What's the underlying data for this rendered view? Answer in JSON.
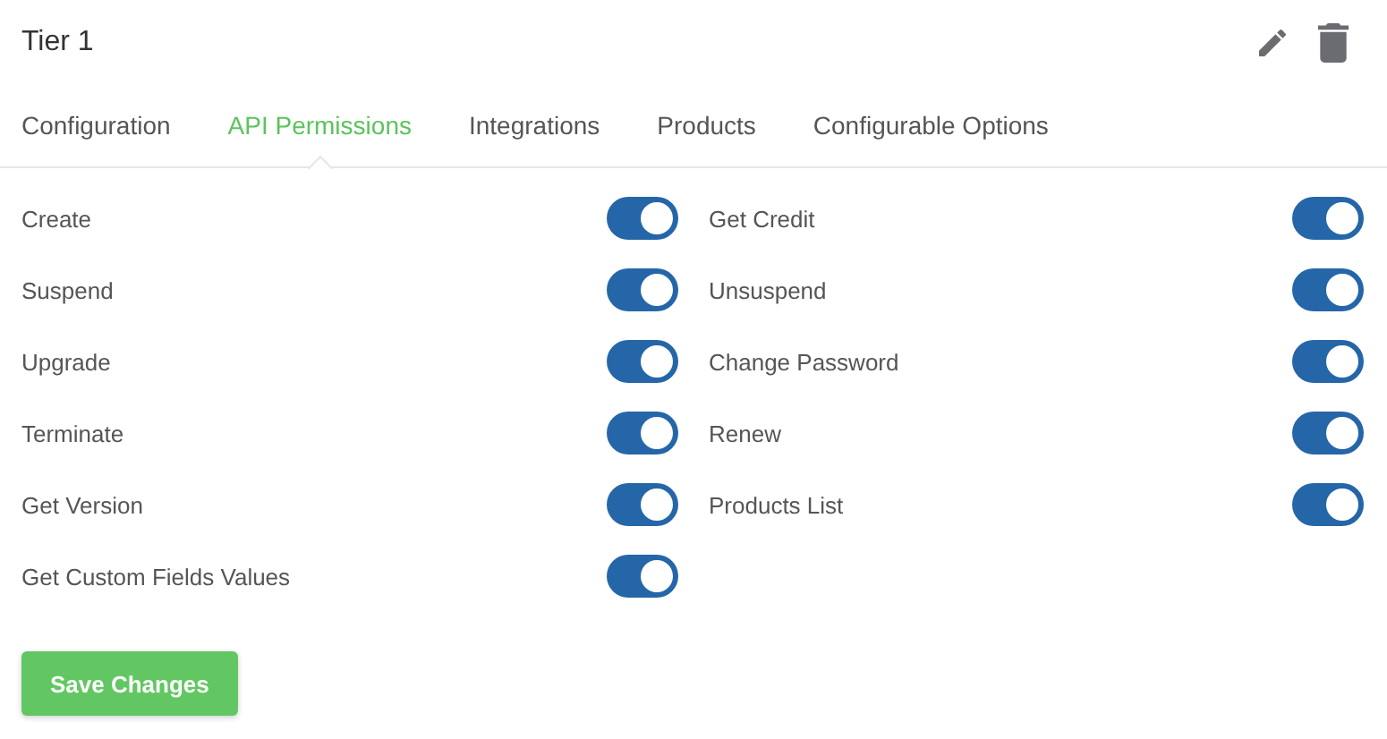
{
  "title": "Tier 1",
  "tabs": [
    {
      "label": "Configuration",
      "selected": false
    },
    {
      "label": "API Permissions",
      "selected": true
    },
    {
      "label": "Integrations",
      "selected": false
    },
    {
      "label": "Products",
      "selected": false
    },
    {
      "label": "Configurable Options",
      "selected": false
    }
  ],
  "permissions": [
    {
      "label": "Create",
      "on": true
    },
    {
      "label": "Get Credit",
      "on": true
    },
    {
      "label": "Suspend",
      "on": true
    },
    {
      "label": "Unsuspend",
      "on": true
    },
    {
      "label": "Upgrade",
      "on": true
    },
    {
      "label": "Change Password",
      "on": true
    },
    {
      "label": "Terminate",
      "on": true
    },
    {
      "label": "Renew",
      "on": true
    },
    {
      "label": "Get Version",
      "on": true
    },
    {
      "label": "Products List",
      "on": true
    },
    {
      "label": "Get Custom Fields Values",
      "on": true
    }
  ],
  "save_button": "Save Changes"
}
